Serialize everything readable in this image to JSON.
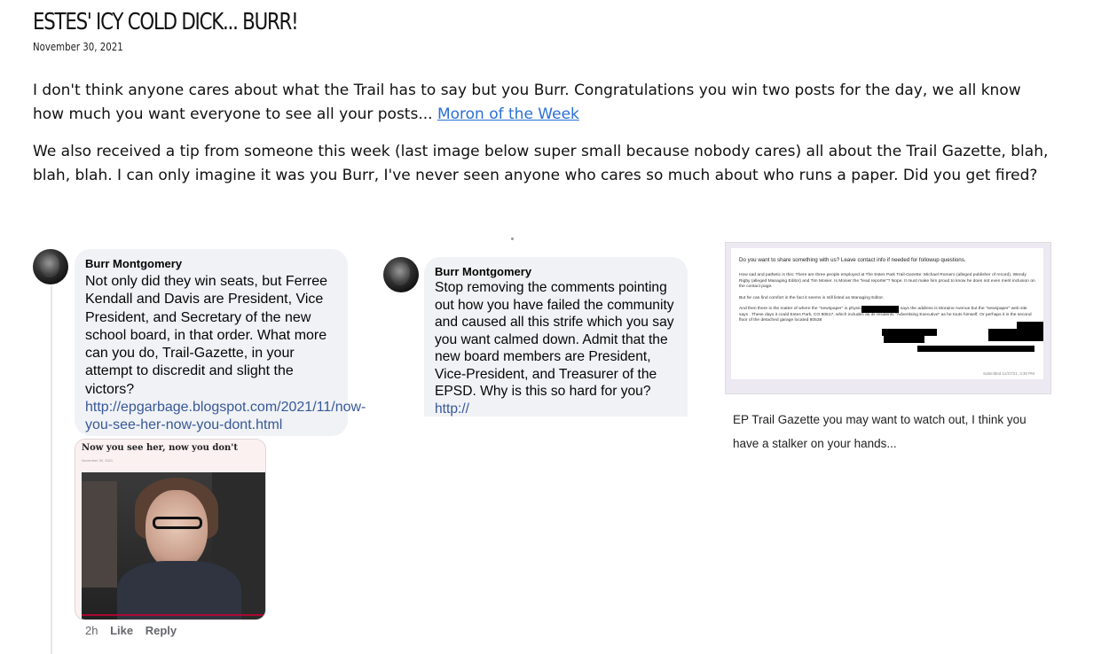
{
  "post": {
    "title": "ESTES' ICY COLD DICK... BURR!",
    "date": "November 30, 2021",
    "paragraph1_text": "I don't think anyone cares about what the Trail has to say but you Burr.  Congratulations you win two posts for the day, we all know how much you want everyone to see all your posts... ",
    "paragraph1_link": "Moron of the Week",
    "paragraph2": "We also received a tip from someone this week (last image below super small because nobody cares) all about the Trail Gazette, blah, blah, blah.  I can only imagine it was you Burr, I've never seen anyone who cares so much about who runs a paper.  Did you get fired?"
  },
  "comment_left": {
    "author": "Burr Montgomery",
    "text": "Not only did they win seats, but Ferree Kendall and Davis are President, Vice President, and Secretary of the new school board, in that order.  What more can you do, Trail-Gazette, in your attempt to discredit and slight the victors?",
    "link": "http://epgarbage.blogspot.com/2021/11/now-you-see-her-now-you-dont.html",
    "preview_title": "Now you see her, now you don't",
    "preview_date": "November 30, 2021",
    "time": "2h",
    "like_label": "Like",
    "reply_label": "Reply"
  },
  "comment_middle": {
    "author": "Burr Montgomery",
    "text": "Stop removing the comments pointing out how you have failed the community and caused all this strife which you say you want calmed down.  Admit that the new board members are President, Vice-President, and Treasurer of the EPSD.  Why is this so hard for you?",
    "link": "http://"
  },
  "tip_form": {
    "question": "Do you want to share something with us? Leave contact info if needed for followup questions.",
    "para1": "How sad and pathetic is this: There are three people employed at The Estes Park Trail-Gazette: Michael Romero (alleged publisher of record), Wendy Rigby (alleged Managing Editor) and Tim Mosier. Is Mosier the \"lead reporter\"? Nope. It must make him proud to know he does not even merit inclusion on the contact page.",
    "para2": "But he can find comfort in the fact it seems                     is still listed as Managing Editor.",
    "para3": "And then there is the matter of where the \"newspaper\" is physically located. Google says the address is                     Moraine Avenue but the \"newspaper\" web site says                     . These days it could                     Estes Park, CO 80517, which includes as its residents                     \"Advertising Executive\" as he touts himself. Or perhaps it is the second floor of the detached garage located                     80538",
    "submitted": "Submitted 11/27/21, 3:30 PM",
    "caption": "EP Trail Gazette you may want to watch out, I think you have a stalker on your hands..."
  }
}
